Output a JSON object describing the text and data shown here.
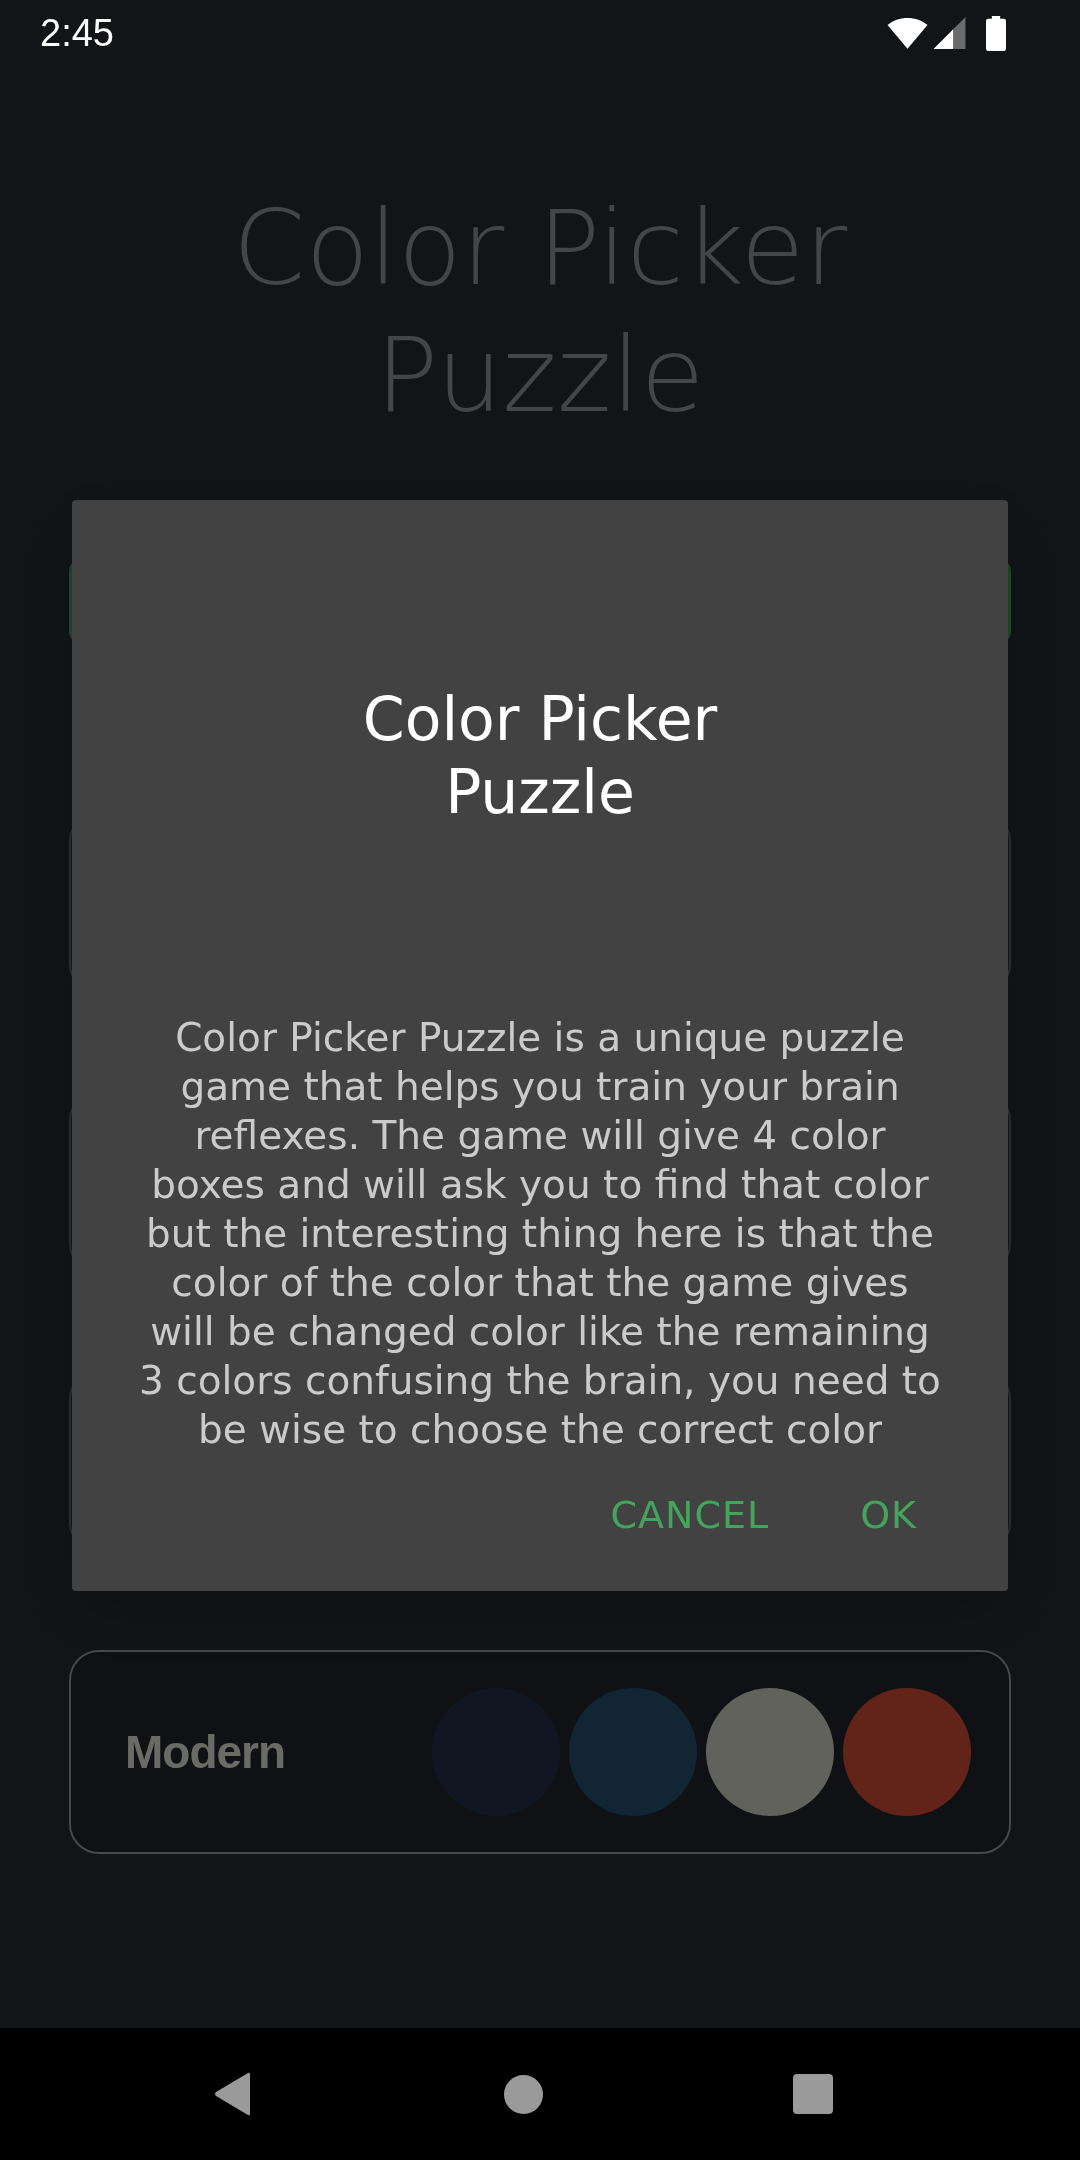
{
  "status_bar": {
    "time": "2:45"
  },
  "screen": {
    "title": "Color Picker Puzzle",
    "cards": [
      {
        "kind": "button",
        "color": "#1e4b2a"
      },
      {
        "kind": "covered",
        "color": "#2d3033"
      },
      {
        "kind": "covered",
        "color": "#2d3033"
      },
      {
        "kind": "covered",
        "color": "#2d3033"
      },
      {
        "kind": "theme",
        "color": "#46484b",
        "label": "Modern",
        "swatches": [
          {
            "color": "#111722"
          },
          {
            "color": "#122533"
          },
          {
            "color": "#62625c"
          },
          {
            "color": "#622419"
          }
        ]
      }
    ]
  },
  "dialog": {
    "title": "Color Picker Puzzle",
    "message": "Color Picker Puzzle is a unique puzzle game that helps you train your brain reflexes. The game will give 4 color boxes and will ask you to find that color but the interesting thing here is that the color of the color that the game gives will be changed color like the remaining 3 colors confusing the brain, you need to be wise to choose the correct color",
    "buttons": [
      {
        "label": "CANCEL"
      },
      {
        "label": "OK"
      }
    ]
  }
}
